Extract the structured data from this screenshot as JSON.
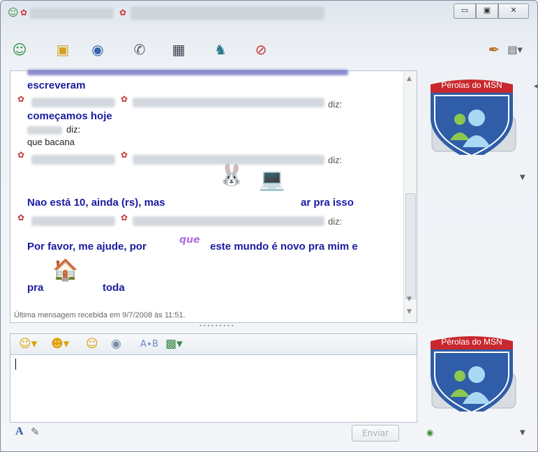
{
  "window": {
    "buttons": {
      "minimize": "▭",
      "maximize": "▣",
      "close": "✕"
    }
  },
  "toolbar": {
    "icons": [
      "add-contact-icon",
      "share-photos-icon",
      "webcam-icon",
      "phone-icon",
      "video-icon",
      "games-icon",
      "block-icon",
      "paint-icon",
      "menu-icon"
    ]
  },
  "chat": {
    "lines": [
      {
        "type": "msg",
        "text": "escreveram"
      },
      {
        "type": "diz",
        "text": "diz:"
      },
      {
        "type": "msg",
        "text": "começamos hoje"
      },
      {
        "type": "diz",
        "text": "diz:"
      },
      {
        "type": "plain",
        "text": "que bacana"
      },
      {
        "type": "diz",
        "text": "diz:"
      },
      {
        "type": "msg",
        "text": "Nao está 10, ainda (rs), mas"
      },
      {
        "type": "msg",
        "text": "ar pra isso"
      },
      {
        "type": "diz",
        "text": "diz:"
      },
      {
        "type": "msg",
        "text": "Por favor, me ajude, por"
      },
      {
        "type": "msg",
        "text": "este mundo é novo pra mim e"
      },
      {
        "type": "msg",
        "text": "pra"
      },
      {
        "type": "msg",
        "text": "toda"
      }
    ],
    "sticker_que": "que",
    "status": "Última mensagem recebida em 9/7/2008 às 11:51."
  },
  "composer": {
    "send_label": "Enviar",
    "font_label": "A"
  },
  "avatars": {
    "label": "Pérolas do MSN"
  },
  "colors": {
    "message": "#1a1aa0",
    "shield_red": "#c8282e",
    "shield_blue": "#2f5da8"
  }
}
